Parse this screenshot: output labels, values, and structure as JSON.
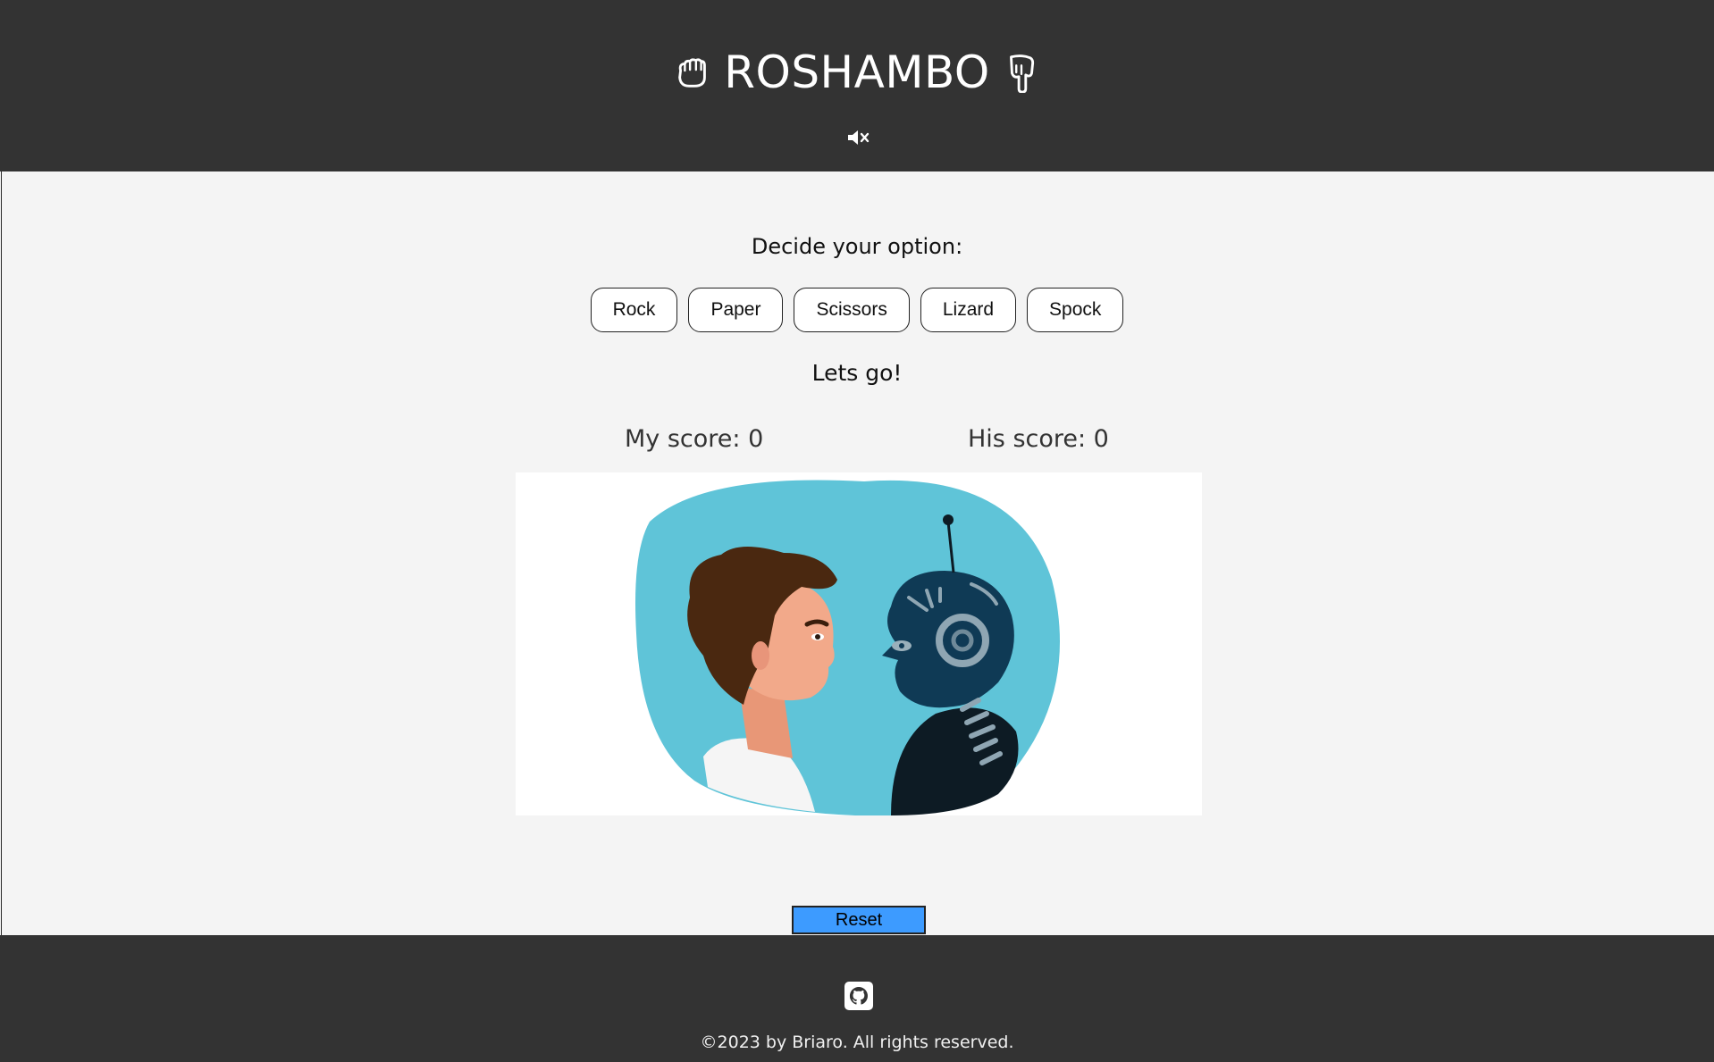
{
  "header": {
    "title": "ROSHAMBO",
    "left_icon": "rock-hand-icon",
    "right_icon": "pointing-down-hand-icon",
    "mute_icon": "volume-mute-icon"
  },
  "game": {
    "prompt": "Decide your option:",
    "options": [
      "Rock",
      "Paper",
      "Scissors",
      "Lizard",
      "Spock"
    ],
    "status": "Lets go!",
    "my_score_label": "My score: 0",
    "his_score_label": "His score: 0"
  },
  "illustration": {
    "subject": "human-vs-robot-illustration",
    "colors": {
      "blob": "#5fc4d8",
      "robot": "#0f3a55",
      "hair": "#4a2810",
      "skin": "#f2a98a"
    }
  },
  "controls": {
    "reset_label": "Reset"
  },
  "footer": {
    "github_icon": "github-icon",
    "copyright": "©2023 by Briaro. All rights reserved."
  },
  "colors": {
    "header_bg": "#333333",
    "page_bg": "#f4f4f4",
    "reset_bg": "#3d9bff"
  }
}
